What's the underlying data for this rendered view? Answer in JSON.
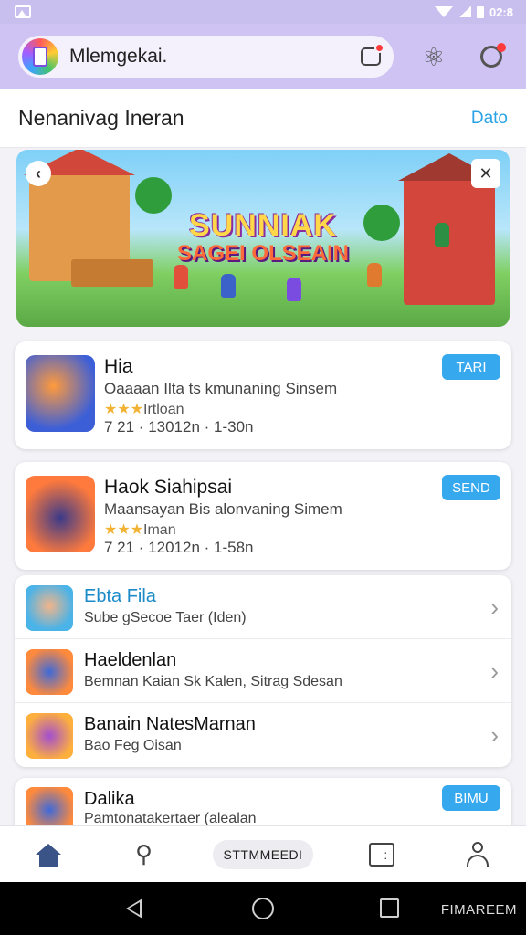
{
  "status_bar": {
    "time": "02:8"
  },
  "header": {
    "search_text": "Mlemgekai."
  },
  "section": {
    "title": "Nenanivag Ineran",
    "link": "Dato"
  },
  "banner": {
    "title": "SUNNIAK",
    "subtitle": "SAGEI OLSEAIN"
  },
  "games": [
    {
      "title": "Hia",
      "subtitle": "Oaaaan Ilta ts kmunaning Sinsem",
      "rating_text": "Irtloan",
      "meta": "7 21 · 13012n · 1-30n",
      "button": "TARI"
    },
    {
      "title": "Haok Siahipsai",
      "subtitle": "Maansayan Bis alonvaning Simem",
      "rating_text": "Iman",
      "meta": "7 21 · 12012n · 1-58n",
      "button": "SEND"
    }
  ],
  "list": [
    {
      "title": "Ebta Fila",
      "subtitle": "Sube gSecoe Taer (Iden)"
    },
    {
      "title": "Haeldenlan",
      "subtitle": "Bemnan Kaian Sk Kalen, Sitrag Sdesan"
    },
    {
      "title": "Banain NatesMarnan",
      "subtitle": "Bao Feg Oisan"
    }
  ],
  "partial": {
    "title": "Dalika",
    "subtitle": "Pamtonatakertaer (alealan",
    "button": "BIMU"
  },
  "bottom_nav": {
    "chip": "STTMMEEDI"
  },
  "system_nav": {
    "label": "FIMAREEM"
  },
  "icons": {
    "inbox": "inbox-icon",
    "share": "share-icon",
    "notifications": "bell-icon",
    "home": "home-icon",
    "pin": "pin-icon",
    "board": "board-icon",
    "profile": "person-icon"
  },
  "colors": {
    "header_bg": "#cec3f2",
    "accent": "#36a8ee",
    "link": "#2aa2e6",
    "nav_active": "#3a5488"
  }
}
